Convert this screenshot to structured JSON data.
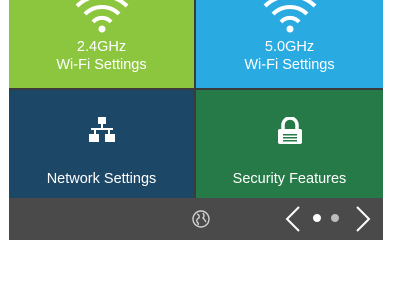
{
  "tiles": [
    {
      "line1": "2.4GHz",
      "line2": "Wi-Fi Settings",
      "icon": "wifi-icon",
      "color": "#8cc63f"
    },
    {
      "line1": "5.0GHz",
      "line2": "Wi-Fi Settings",
      "icon": "wifi-icon",
      "color": "#29abe2"
    },
    {
      "label": "Network Settings",
      "icon": "network-icon",
      "color": "#1c4766"
    },
    {
      "label": "Security Features",
      "icon": "lock-icon",
      "color": "#267a47"
    }
  ],
  "footer": {
    "globe_icon": "globe-icon",
    "prev_icon": "chevron-left-icon",
    "next_icon": "chevron-right-icon",
    "page_indicator": {
      "current": 1,
      "total": 2
    }
  }
}
